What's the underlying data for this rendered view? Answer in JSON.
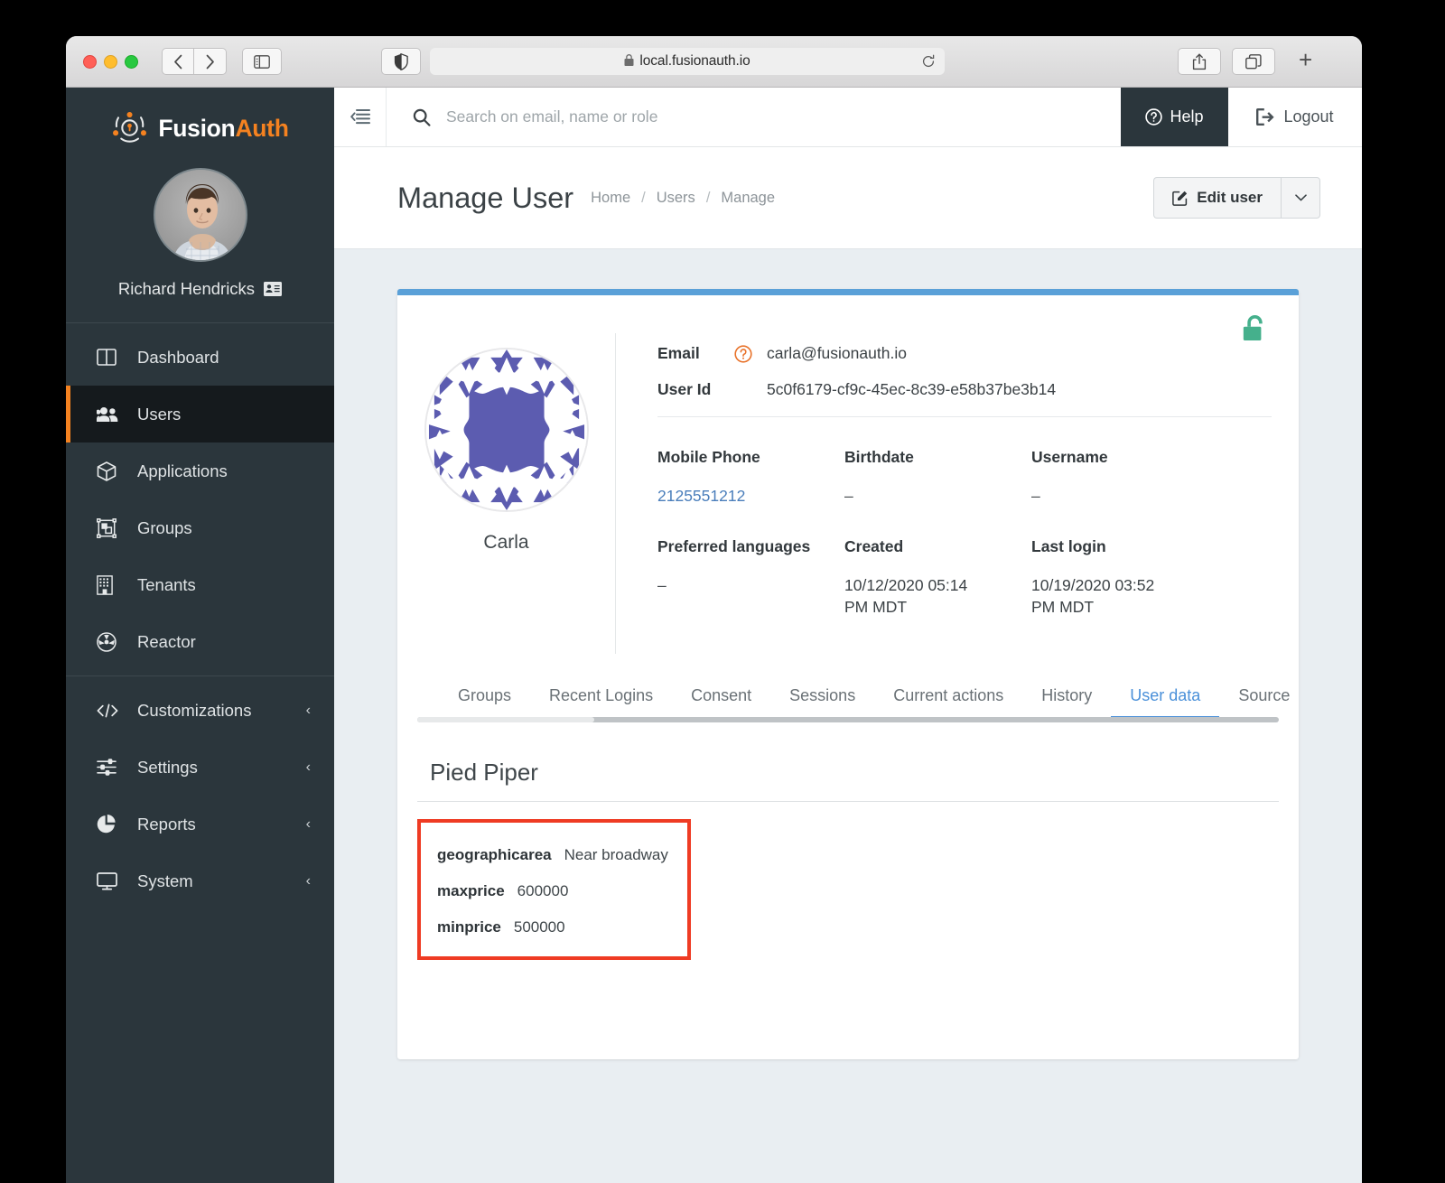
{
  "browser": {
    "url": "local.fusionauth.io",
    "lock_icon": "lock-icon",
    "back_icon": "chevron-left-icon",
    "forward_icon": "chevron-right-icon",
    "sidebar_toggle_icon": "sidebar-toggle-icon",
    "shield_icon": "shield-icon",
    "reload_icon": "reload-icon",
    "share_icon": "share-icon",
    "tabs_icon": "tab-overview-icon",
    "newtab_label": "+"
  },
  "sidebar": {
    "brand": {
      "fusion": "Fusion",
      "auth": "Auth"
    },
    "user": {
      "name": "Richard Hendricks",
      "card_icon": "id-card-icon"
    },
    "nav_primary": [
      {
        "label": "Dashboard",
        "icon": "dashboard-icon",
        "active": false
      },
      {
        "label": "Users",
        "icon": "users-icon",
        "active": true
      },
      {
        "label": "Applications",
        "icon": "cube-icon",
        "active": false
      },
      {
        "label": "Groups",
        "icon": "groups-icon",
        "active": false
      },
      {
        "label": "Tenants",
        "icon": "building-icon",
        "active": false
      },
      {
        "label": "Reactor",
        "icon": "reactor-icon",
        "active": false
      }
    ],
    "nav_secondary": [
      {
        "label": "Customizations",
        "icon": "code-icon",
        "chevron": "‹"
      },
      {
        "label": "Settings",
        "icon": "sliders-icon",
        "chevron": "‹"
      },
      {
        "label": "Reports",
        "icon": "pie-chart-icon",
        "chevron": "‹"
      },
      {
        "label": "System",
        "icon": "monitor-icon",
        "chevron": "‹"
      }
    ]
  },
  "topbar": {
    "hamburger_icon": "collapse-menu-icon",
    "search_placeholder": "Search on email, name or role",
    "search_value": "",
    "search_icon": "search-icon",
    "help_label": "Help",
    "help_icon": "question-circle-icon",
    "logout_label": "Logout",
    "logout_icon": "logout-icon"
  },
  "page": {
    "title": "Manage User",
    "breadcrumb": [
      "Home",
      "Users",
      "Manage"
    ],
    "breadcrumb_sep": "/",
    "edit_user_label": "Edit user",
    "edit_user_icon": "pencil-square-icon",
    "edit_user_caret": "⌄"
  },
  "user_card": {
    "lock_icon": "unlock-icon",
    "lock_color": "#45b08c",
    "accent_color": "#5aa0d8",
    "avatar_name": "Carla",
    "avatar_color": "#5c5cb0",
    "email_label": "Email",
    "email_value": "carla@fusionauth.io",
    "email_help_icon": "question-circle-icon",
    "userid_label": "User Id",
    "userid_value": "5c0f6179-cf9c-45ec-8c39-e58b37be3b14",
    "fields": [
      {
        "label": "Mobile Phone",
        "value": "2125551212",
        "style": "link"
      },
      {
        "label": "Birthdate",
        "value": "–",
        "style": "dash"
      },
      {
        "label": "Username",
        "value": "–",
        "style": "dash"
      },
      {
        "label": "Preferred languages",
        "value": "–",
        "style": "dash"
      },
      {
        "label": "Created",
        "value": "10/12/2020 05:14 PM MDT",
        "style": "plain"
      },
      {
        "label": "Last login",
        "value": "10/19/2020 03:52 PM MDT",
        "style": "plain"
      }
    ],
    "tabs": [
      {
        "label": "Groups",
        "active": false
      },
      {
        "label": "Recent Logins",
        "active": false
      },
      {
        "label": "Consent",
        "active": false
      },
      {
        "label": "Sessions",
        "active": false
      },
      {
        "label": "Current actions",
        "active": false
      },
      {
        "label": "History",
        "active": false
      },
      {
        "label": "User data",
        "active": true
      },
      {
        "label": "Source",
        "active": false
      }
    ],
    "user_data": {
      "section_title": "Pied Piper",
      "highlight_color": "#ef3b23",
      "entries": [
        {
          "key": "geographicarea",
          "value": "Near broadway"
        },
        {
          "key": "maxprice",
          "value": "600000"
        },
        {
          "key": "minprice",
          "value": "500000"
        }
      ]
    }
  }
}
